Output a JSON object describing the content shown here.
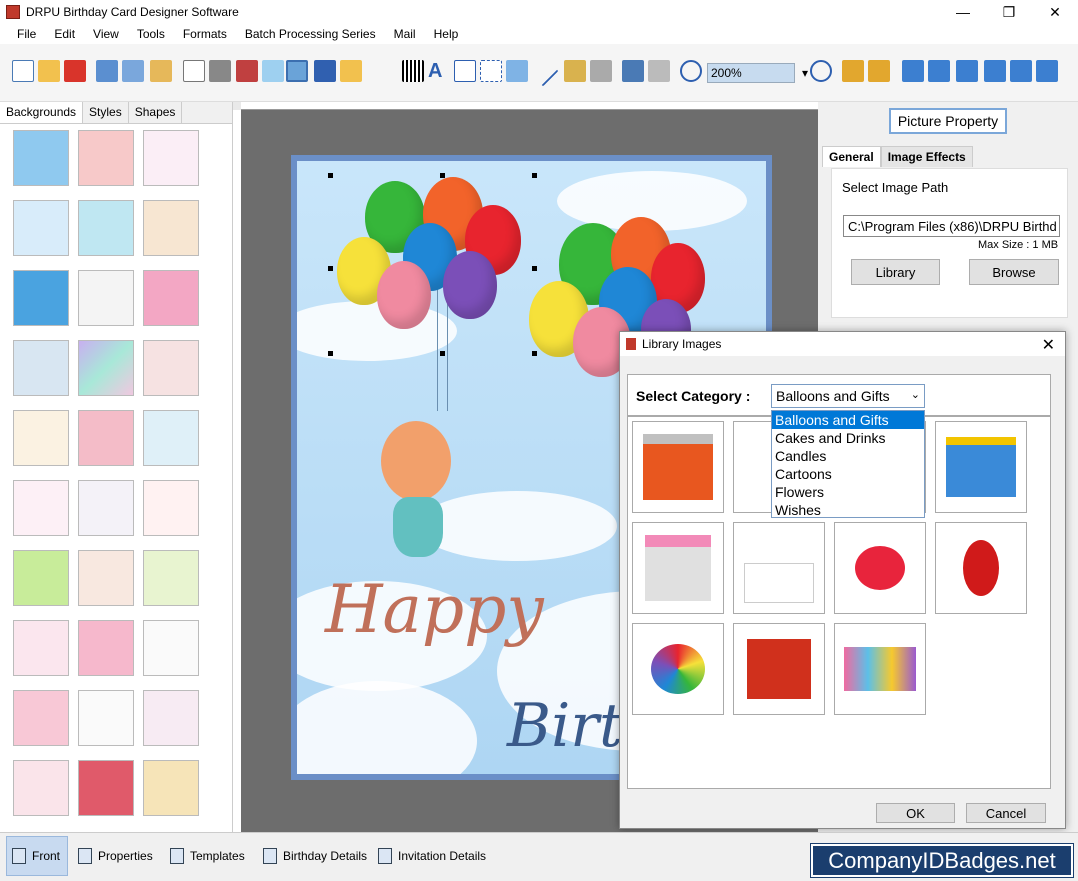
{
  "window": {
    "title": "DRPU Birthday Card Designer Software",
    "minimize": "—",
    "maximize": "❐",
    "close": "✕"
  },
  "menu": [
    "File",
    "Edit",
    "View",
    "Tools",
    "Formats",
    "Batch Processing Series",
    "Mail",
    "Help"
  ],
  "toolbar": {
    "zoom": "200%"
  },
  "left_panel": {
    "tabs": [
      "Backgrounds",
      "Styles",
      "Shapes"
    ],
    "active_tab": "Backgrounds"
  },
  "right_panel": {
    "header": "Picture Property",
    "tabs": [
      "General",
      "Image Effects"
    ],
    "path_label": "Select Image Path",
    "path_value": "C:\\Program Files (x86)\\DRPU Birthd",
    "max_size": "Max Size : 1 MB",
    "library_button": "Library",
    "browse_button": "Browse"
  },
  "card": {
    "text1": "Happy",
    "text2": "Birt"
  },
  "dialog": {
    "title": "Library Images",
    "close": "✕",
    "category_label": "Select Category :",
    "category_value": "Balloons and Gifts",
    "categories": [
      "Balloons and Gifts",
      "Cakes and Drinks",
      "Candles",
      "Cartoons",
      "Flowers",
      "Wishes"
    ],
    "ok": "OK",
    "cancel": "Cancel"
  },
  "bottom_tabs": [
    "Front",
    "Properties",
    "Templates",
    "Birthday Details",
    "Invitation Details"
  ],
  "brand": "CompanyIDBadges.net",
  "colors": {
    "accent": "#0078d7",
    "brand_bg": "#1b3e6e",
    "card_frame": "#6b8fc7"
  }
}
